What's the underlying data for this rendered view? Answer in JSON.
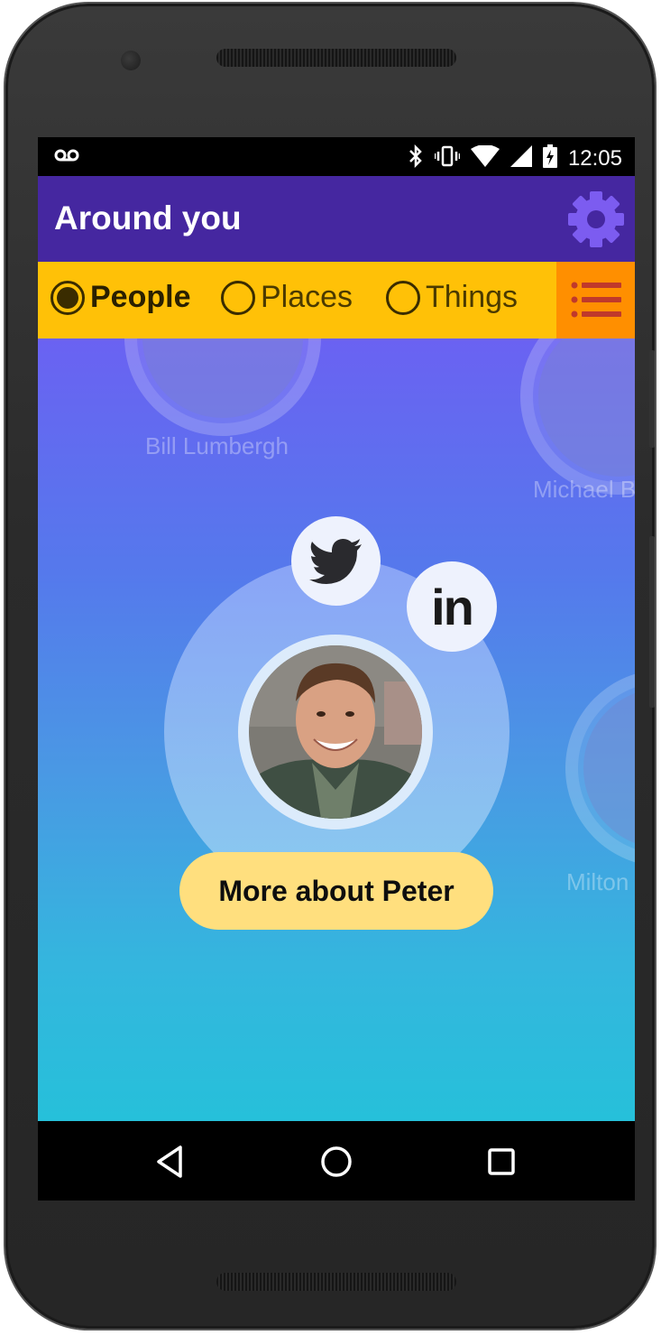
{
  "status_bar": {
    "time": "12:05",
    "icons": [
      "voicemail-icon",
      "bluetooth-icon",
      "vibrate-icon",
      "wifi-icon",
      "signal-icon",
      "battery-charging-icon"
    ]
  },
  "app_bar": {
    "title": "Around you",
    "settings_icon": "gear-icon"
  },
  "filters": {
    "options": [
      {
        "label": "People",
        "selected": true
      },
      {
        "label": "Places",
        "selected": false
      },
      {
        "label": "Things",
        "selected": false
      }
    ],
    "list_icon": "list-icon"
  },
  "nearby_people": [
    {
      "name": "Bill Lumbergh"
    },
    {
      "name": "Michael B"
    },
    {
      "name": "Milton"
    }
  ],
  "focused_person": {
    "social": [
      "twitter-icon",
      "linkedin-icon"
    ],
    "linkedin_text": "in",
    "more_button": "More about Peter"
  },
  "nav_bar": {
    "icons": [
      "back-icon",
      "home-icon",
      "recents-icon"
    ]
  },
  "colors": {
    "app_bar": "#4527a0",
    "filter_bar": "#ffc107",
    "list_button": "#ff8f00",
    "gear": "#7c5cf0",
    "more_button": "#ffdf7e"
  }
}
